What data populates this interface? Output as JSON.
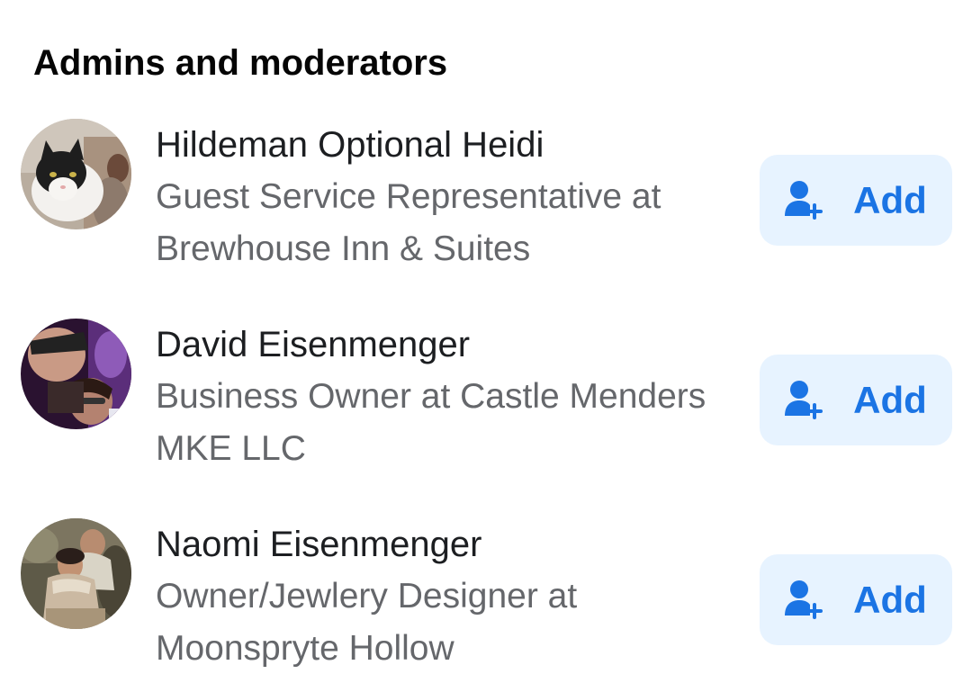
{
  "section": {
    "title": "Admins and moderators"
  },
  "members": [
    {
      "name": "Hildeman Optional Heidi",
      "subtitle": "Guest Service Representative at Brewhouse Inn & Suites",
      "add_label": "Add"
    },
    {
      "name": "David Eisenmenger",
      "subtitle": "Business Owner at Castle Menders MKE LLC",
      "add_label": "Add"
    },
    {
      "name": "Naomi Eisenmenger",
      "subtitle": "Owner/Jewlery Designer at Moonspryte Hollow",
      "add_label": "Add"
    }
  ],
  "colors": {
    "accent": "#1b74e4",
    "button_bg": "#e7f3ff",
    "text_primary": "#1c1e21",
    "text_secondary": "#65676b"
  }
}
